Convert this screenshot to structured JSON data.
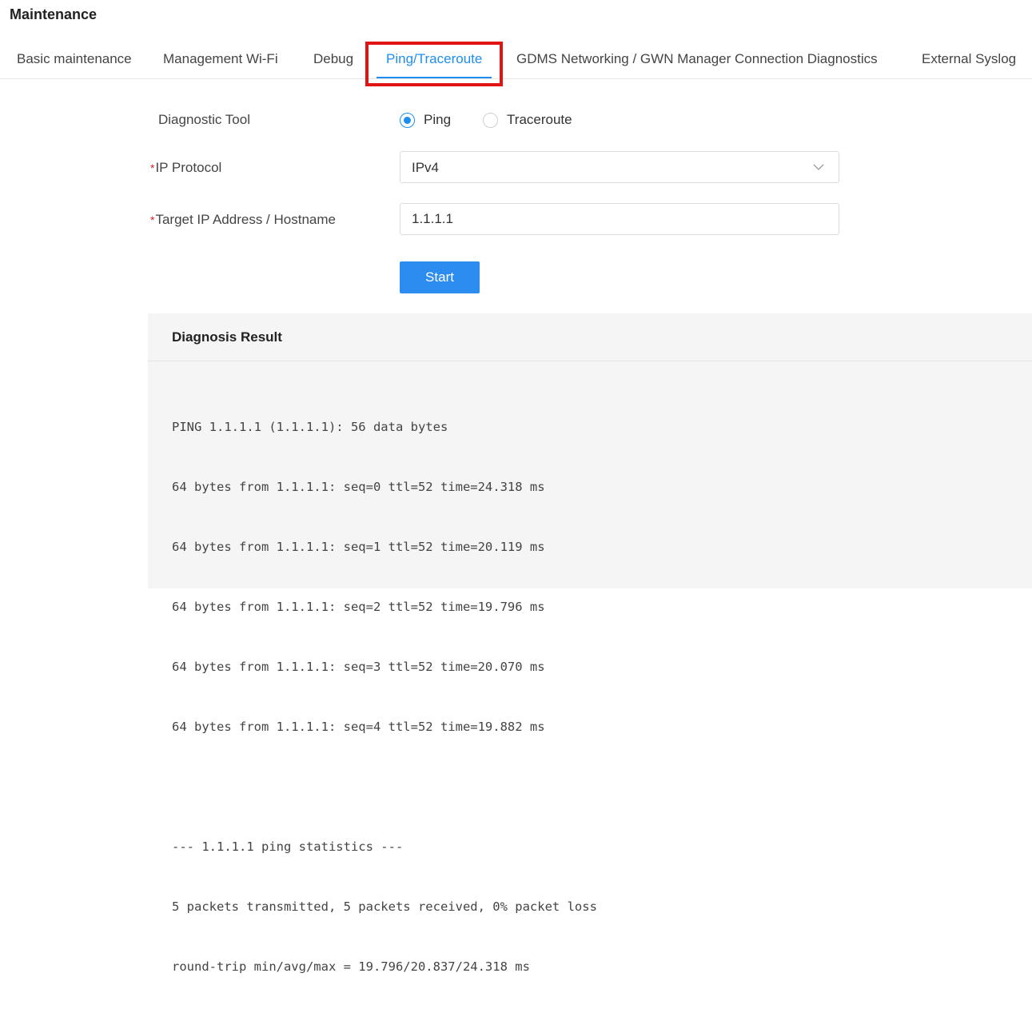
{
  "page": {
    "title": "Maintenance"
  },
  "tabs": [
    {
      "label": "Basic maintenance",
      "active": false
    },
    {
      "label": "Management Wi-Fi",
      "active": false
    },
    {
      "label": "Debug",
      "active": false
    },
    {
      "label": "Ping/Traceroute",
      "active": true
    },
    {
      "label": "GDMS Networking / GWN Manager Connection Diagnostics",
      "active": false
    },
    {
      "label": "External Syslog",
      "active": false
    }
  ],
  "form": {
    "diagnostic_tool": {
      "label": "Diagnostic Tool",
      "options": [
        "Ping",
        "Traceroute"
      ],
      "selected": "Ping"
    },
    "ip_protocol": {
      "required_mark": "*",
      "label": "IP Protocol",
      "value": "IPv4"
    },
    "target": {
      "required_mark": "*",
      "label": "Target IP Address / Hostname",
      "value": "1.1.1.1"
    },
    "start_label": "Start"
  },
  "result": {
    "title": "Diagnosis Result",
    "lines": [
      "PING 1.1.1.1 (1.1.1.1): 56 data bytes",
      "64 bytes from 1.1.1.1: seq=0 ttl=52 time=24.318 ms",
      "64 bytes from 1.1.1.1: seq=1 ttl=52 time=20.119 ms",
      "64 bytes from 1.1.1.1: seq=2 ttl=52 time=19.796 ms",
      "64 bytes from 1.1.1.1: seq=3 ttl=52 time=20.070 ms",
      "64 bytes from 1.1.1.1: seq=4 ttl=52 time=19.882 ms",
      "",
      "--- 1.1.1.1 ping statistics ---",
      "5 packets transmitted, 5 packets received, 0% packet loss",
      "round-trip min/avg/max = 19.796/20.837/24.318 ms"
    ]
  },
  "colors": {
    "accent": "#1f8ef1",
    "highlight": "#e01414",
    "required": "#e02020",
    "result_bg": "#f5f5f5"
  }
}
